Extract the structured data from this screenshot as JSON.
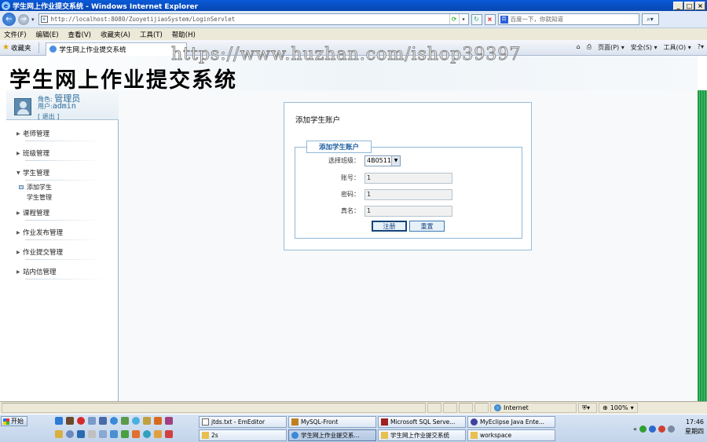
{
  "window": {
    "title": "学生网上作业提交系统 - Windows Internet Explorer",
    "minimize": "_",
    "maximize": "□",
    "close": "×"
  },
  "address_bar": {
    "url": "http://localhost:8080/ZuoyetijiaoSystem/LoginServlet",
    "search_placeholder": "百度一下，你就知道"
  },
  "menu": [
    "文件(F)",
    "编辑(E)",
    "查看(V)",
    "收藏夹(A)",
    "工具(T)",
    "帮助(H)"
  ],
  "favorites_bar": {
    "favorites_label": "收藏夹",
    "tab_title": "学生网上作业提交系统",
    "tools": [
      "页面(P) ▾",
      "安全(S) ▾",
      "工具(O) ▾"
    ]
  },
  "watermark": "https://www.huzhan.com/ishop39397",
  "page": {
    "system_title": "学生网上作业提交系统",
    "user": {
      "role_label": "角色:",
      "role_value": "管理员",
      "user_label": "用户:",
      "user_value": "admin",
      "logout": "[ 退出 ]"
    },
    "sidebar": {
      "groups": [
        {
          "label": "老师管理"
        },
        {
          "label": "班级管理"
        },
        {
          "label": "学生管理"
        },
        {
          "label": "课程管理"
        },
        {
          "label": "作业发布管理"
        },
        {
          "label": "作业提交管理"
        },
        {
          "label": "站内信管理"
        }
      ],
      "student_sub": [
        "添加学生",
        "学生管理"
      ]
    },
    "form": {
      "card_title": "添加学生账户",
      "legend": "添加学生账户",
      "class_label": "选择班级：",
      "class_value": "4B0511",
      "account_label": "账号：",
      "account_value": "1",
      "password_label": "密码：",
      "password_value": "1",
      "realname_label": "真名：",
      "realname_value": "1",
      "submit": "注册",
      "reset": "重置"
    }
  },
  "statusbar": {
    "zone": "Internet",
    "zoom": "100%"
  },
  "taskbar": {
    "start": "开始",
    "buttons": [
      "jtds.txt - EmEditor",
      "MySQL-Front",
      "Microsoft SQL Serve...",
      "MyEclipse Java Ente...",
      "2s",
      "学生网上作业提交系...",
      "学生网上作业提交系统",
      "workspace"
    ],
    "time": "17:46",
    "day": "星期四"
  }
}
